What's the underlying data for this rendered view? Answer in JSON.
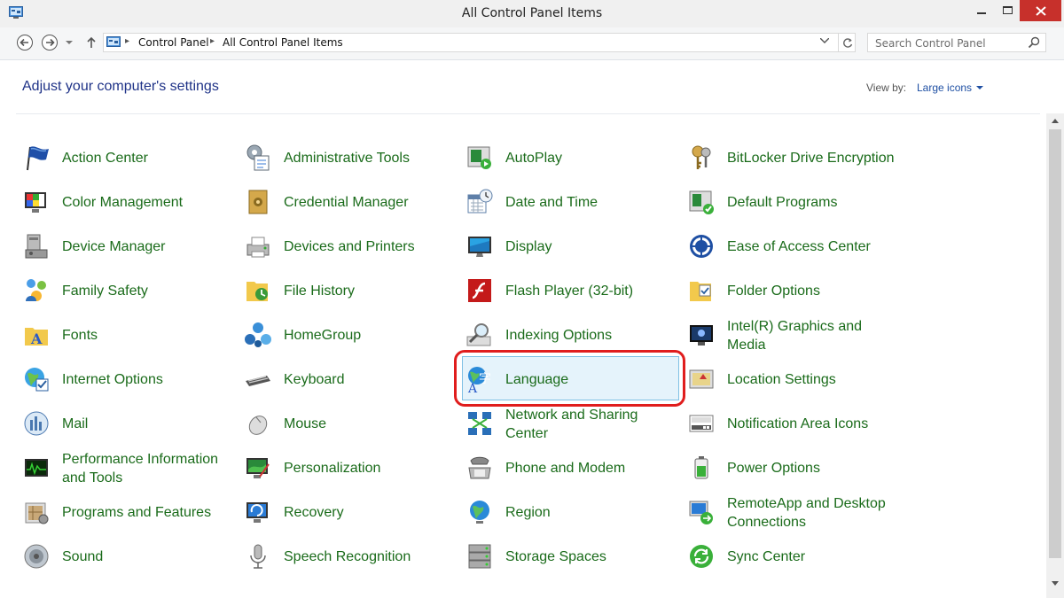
{
  "window": {
    "title": "All Control Panel Items",
    "colors": {
      "close_bg": "#c7302b",
      "link": "#1e3287",
      "item_text": "#1a6b1a",
      "highlight": "#e01d1d",
      "selected_bg": "#e5f3fb"
    }
  },
  "address": {
    "crumbs": [
      "Control Panel",
      "All Control Panel Items"
    ]
  },
  "search": {
    "placeholder": "Search Control Panel"
  },
  "header": {
    "title": "Adjust your computer's settings",
    "view_by_label": "View by:",
    "view_by_value": "Large icons"
  },
  "items": {
    "action_center": {
      "label": "Action Center",
      "icon": "flag-icon"
    },
    "administrative_tools": {
      "label": "Administrative Tools",
      "icon": "admin-tools-icon"
    },
    "autoplay": {
      "label": "AutoPlay",
      "icon": "autoplay-icon"
    },
    "bitlocker": {
      "label": "BitLocker Drive Encryption",
      "icon": "keys-icon"
    },
    "color_management": {
      "label": "Color Management",
      "icon": "color-monitor-icon"
    },
    "credential_manager": {
      "label": "Credential Manager",
      "icon": "vault-icon"
    },
    "date_time": {
      "label": "Date and Time",
      "icon": "calendar-clock-icon"
    },
    "default_programs": {
      "label": "Default Programs",
      "icon": "default-programs-icon"
    },
    "device_manager": {
      "label": "Device Manager",
      "icon": "device-manager-icon"
    },
    "devices_printers": {
      "label": "Devices and Printers",
      "icon": "printer-icon"
    },
    "display": {
      "label": "Display",
      "icon": "display-icon"
    },
    "ease_of_access": {
      "label": "Ease of Access Center",
      "icon": "ease-of-access-icon"
    },
    "family_safety": {
      "label": "Family Safety",
      "icon": "family-icon"
    },
    "file_history": {
      "label": "File History",
      "icon": "file-history-icon"
    },
    "flash_player": {
      "label": "Flash Player (32-bit)",
      "icon": "flash-icon"
    },
    "folder_options": {
      "label": "Folder Options",
      "icon": "folder-options-icon"
    },
    "fonts": {
      "label": "Fonts",
      "icon": "fonts-folder-icon"
    },
    "homegroup": {
      "label": "HomeGroup",
      "icon": "homegroup-icon"
    },
    "indexing_options": {
      "label": "Indexing Options",
      "icon": "magnifier-icon"
    },
    "intel_graphics": {
      "label": "Intel(R) Graphics and Media",
      "icon": "intel-graphics-icon"
    },
    "internet_options": {
      "label": "Internet Options",
      "icon": "globe-check-icon"
    },
    "keyboard": {
      "label": "Keyboard",
      "icon": "keyboard-icon"
    },
    "language": {
      "label": "Language",
      "icon": "language-icon"
    },
    "location_settings": {
      "label": "Location Settings",
      "icon": "location-icon"
    },
    "mail": {
      "label": "Mail",
      "icon": "mail-icon"
    },
    "mouse": {
      "label": "Mouse",
      "icon": "mouse-icon"
    },
    "network_sharing": {
      "label": "Network and Sharing Center",
      "icon": "network-icon"
    },
    "notification_area": {
      "label": "Notification Area Icons",
      "icon": "notification-icon"
    },
    "performance": {
      "label": "Performance Information and Tools",
      "icon": "performance-icon"
    },
    "personalization": {
      "label": "Personalization",
      "icon": "personalization-icon"
    },
    "phone_modem": {
      "label": "Phone and Modem",
      "icon": "phone-icon"
    },
    "power_options": {
      "label": "Power Options",
      "icon": "battery-icon"
    },
    "programs_features": {
      "label": "Programs and Features",
      "icon": "programs-icon"
    },
    "recovery": {
      "label": "Recovery",
      "icon": "recovery-icon"
    },
    "region": {
      "label": "Region",
      "icon": "region-globe-icon"
    },
    "remoteapp": {
      "label": "RemoteApp and Desktop Connections",
      "icon": "remoteapp-icon"
    },
    "sound": {
      "label": "Sound",
      "icon": "speaker-icon"
    },
    "speech_recognition": {
      "label": "Speech Recognition",
      "icon": "microphone-icon"
    },
    "storage_spaces": {
      "label": "Storage Spaces",
      "icon": "storage-icon"
    },
    "sync_center": {
      "label": "Sync Center",
      "icon": "sync-icon"
    }
  }
}
